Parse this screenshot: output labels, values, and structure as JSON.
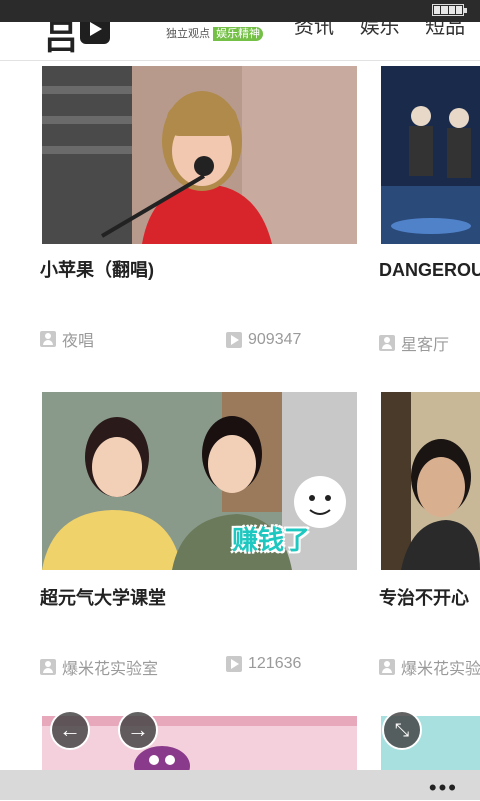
{
  "header": {
    "logo_glyphs": "吕",
    "slogan": "独立观点",
    "slogan_tag": "娱乐精神",
    "nav": [
      "资讯",
      "娱乐",
      "短品"
    ]
  },
  "cards": [
    {
      "title": "小苹果（翻唱)",
      "author": "夜唱",
      "plays": "909347",
      "thumb_icon": "singer-thumbnail"
    },
    {
      "title": "DANGEROU",
      "author": "星客厅",
      "plays": "",
      "thumb_icon": "dancers-thumbnail"
    },
    {
      "title": "超元气大学课堂",
      "author": "爆米花实验室",
      "plays": "121636",
      "thumb_icon": "students-thumbnail",
      "overlay_text": "赚钱了"
    },
    {
      "title": "专治不开心",
      "author": "爆米花实验",
      "plays": "",
      "thumb_icon": "man-thumbnail"
    }
  ],
  "controls": {
    "back_glyph": "←",
    "forward_glyph": "→",
    "collapse_glyph": "⤡",
    "more_glyph": "•••"
  },
  "colors": {
    "status_bar": "#2b2b2b",
    "accent_green": "#74c047",
    "app_bar": "#d9d9d9"
  }
}
